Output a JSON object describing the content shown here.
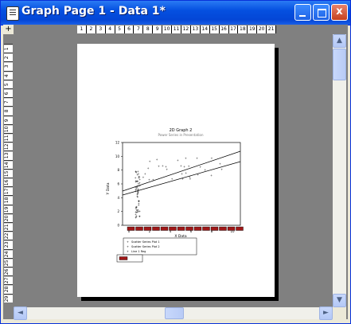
{
  "window": {
    "title": "Graph Page 1 - Data 1*",
    "buttons": {
      "minimize": "_",
      "close": "x"
    }
  },
  "rulers": {
    "corner": "+",
    "horizontal_ticks": [
      "1",
      "2",
      "3",
      "4",
      "5",
      "6",
      "7",
      "8",
      "9",
      "10",
      "11",
      "12",
      "13",
      "14",
      "15",
      "16",
      "17",
      "18",
      "19",
      "20",
      "21"
    ],
    "vertical_ticks": [
      "1",
      "2",
      "3",
      "4",
      "5",
      "6",
      "7",
      "8",
      "9",
      "10",
      "11",
      "12",
      "13",
      "14",
      "15",
      "16",
      "17",
      "18",
      "19",
      "20",
      "21",
      "22",
      "23",
      "24",
      "25",
      "26",
      "27",
      "28",
      "29"
    ]
  },
  "graph": {
    "title": "2D Graph 2",
    "subtitle": "Power Series in Presentation",
    "ylabel": "Y Data",
    "xlabel": "X Data",
    "xticks": [
      "0",
      "2",
      "4",
      "6",
      "8",
      "10"
    ],
    "yticks": [
      "0",
      "2",
      "4",
      "6",
      "8",
      "10",
      "12"
    ],
    "legend": {
      "entries": [
        "Scatter Series Plot 1",
        "Scatter Series Plot 2",
        "Line 1 Reg"
      ]
    },
    "colors": {
      "bar_fill": "#a01818",
      "bar_edge": "#000000",
      "axis": "#000000"
    }
  },
  "scrollbars": {
    "up": "▲",
    "down": "▼",
    "left": "◄",
    "right": "►"
  }
}
